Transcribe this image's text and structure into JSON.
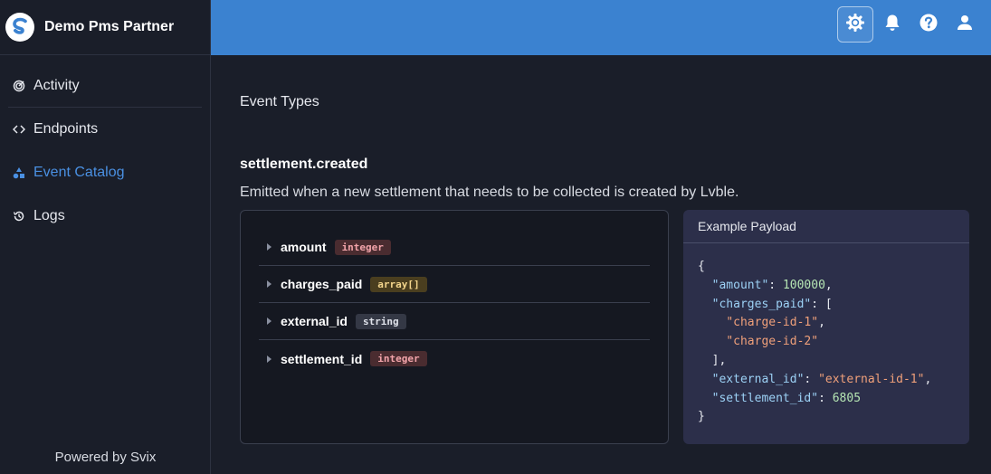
{
  "brand": {
    "name": "Demo Pms Partner"
  },
  "sidebar": {
    "items": [
      {
        "label": "Activity",
        "icon": "activity-icon"
      },
      {
        "label": "Endpoints",
        "icon": "code-icon"
      },
      {
        "label": "Event Catalog",
        "icon": "shapes-icon",
        "active": true
      },
      {
        "label": "Logs",
        "icon": "history-icon"
      }
    ],
    "footer": "Powered by Svix"
  },
  "topbar": {
    "icons": [
      "settings-icon",
      "bell-icon",
      "help-icon",
      "user-icon"
    ]
  },
  "main": {
    "page_title": "Event Types",
    "event_name": "settlement.created",
    "event_description": "Emitted when a new settlement that needs to be collected is created by Lvble.",
    "schema": [
      {
        "name": "amount",
        "type": "integer"
      },
      {
        "name": "charges_paid",
        "type": "array[]"
      },
      {
        "name": "external_id",
        "type": "string"
      },
      {
        "name": "settlement_id",
        "type": "integer"
      }
    ],
    "payload": {
      "title": "Example Payload",
      "lines": {
        "l0": "{",
        "amount_key": "\"amount\"",
        "amount_val": "100000",
        "charges_key": "\"charges_paid\"",
        "charge1": "\"charge-id-1\"",
        "charge2": "\"charge-id-2\"",
        "external_key": "\"external_id\"",
        "external_val": "\"external-id-1\"",
        "settlement_key": "\"settlement_id\"",
        "settlement_val": "6805",
        "l_end": "}"
      }
    }
  },
  "colors": {
    "accent": "#3b82d0",
    "active": "#4a90e2"
  }
}
